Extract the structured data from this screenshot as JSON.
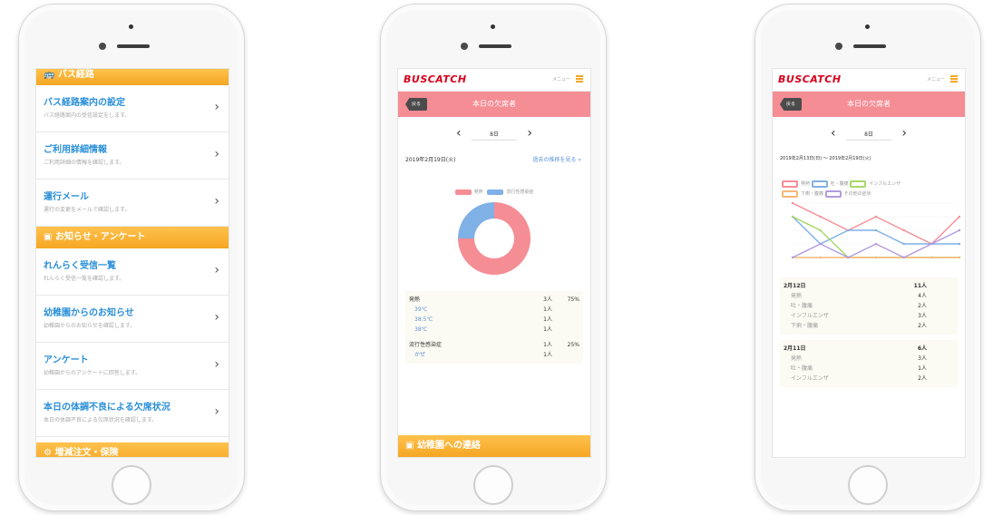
{
  "phone1": {
    "top_section": "バス経路",
    "items": [
      {
        "title": "バス経路案内の設定",
        "sub": "バス経路案内の受信設定をします。"
      },
      {
        "title": "ご利用詳細情報",
        "sub": "ご利用詳細の情報を確認します。"
      },
      {
        "title": "運行メール",
        "sub": "運行の変更をメールで確認します。"
      }
    ],
    "section2": "お知らせ・アンケート",
    "items2": [
      {
        "title": "れんらく受信一覧",
        "sub": "れんらく受信一覧を確認します。"
      },
      {
        "title": "幼稚園からのお知らせ",
        "sub": "幼稚園からのお知らせを確認します。"
      },
      {
        "title": "アンケート",
        "sub": "幼稚園からのアンケートに回答します。"
      },
      {
        "title": "本日の体調不良による欠席状況",
        "sub": "本日の体調不良による欠席状況を確認します。"
      }
    ],
    "bottom_section": "増減注文・保険"
  },
  "phone2": {
    "logo": "BUSCATCH",
    "menu_label": "メニュー",
    "title": "本日の欠席者",
    "back": "戻る",
    "date": "8日",
    "date_full": "2019年2月19日(火)",
    "past_link": "過去の推移を見る",
    "legend": [
      "発熱",
      "流行性感染症"
    ],
    "table": [
      {
        "label": "発熱",
        "count": "3人",
        "pct": "75%",
        "kind": "head"
      },
      {
        "label": "39℃",
        "count": "1人",
        "kind": "sub"
      },
      {
        "label": "38.5℃",
        "count": "1人",
        "kind": "sub"
      },
      {
        "label": "38℃",
        "count": "1人",
        "kind": "sub"
      },
      {
        "label": "流行性感染症",
        "count": "1人",
        "pct": "25%",
        "kind": "head"
      },
      {
        "label": "かぜ",
        "count": "1人",
        "kind": "sub"
      }
    ],
    "footer": "幼稚園への連絡"
  },
  "phone3": {
    "logo": "BUSCATCH",
    "menu_label": "メニュー",
    "title": "本日の欠席者",
    "back": "戻る",
    "date": "8日",
    "date_range": "2019年2月13日(日) 〜 2019年2月19日(火)",
    "legend": [
      "発熱",
      "吐・腹痛",
      "インフルエンザ",
      "下痢・腹痛",
      "その他の症状"
    ],
    "day1": {
      "title": "2月12日",
      "total": "11人",
      "rows": [
        {
          "label": "発熱",
          "count": "4人"
        },
        {
          "label": "吐・腹痛",
          "count": "2人"
        },
        {
          "label": "インフルエンザ",
          "count": "3人"
        },
        {
          "label": "下痢・腹痛",
          "count": "2人"
        }
      ]
    },
    "day2": {
      "title": "2月11日",
      "total": "6人",
      "rows": [
        {
          "label": "発熱",
          "count": "3人"
        },
        {
          "label": "吐・腹痛",
          "count": "1人"
        },
        {
          "label": "インフルエンザ",
          "count": "2人"
        }
      ]
    }
  },
  "colors": {
    "orange": "#f5a623",
    "pink": "#f58d95",
    "blue": "#2a8fd8",
    "donut_pink": "#f58d95",
    "donut_blue": "#7fb0e6"
  },
  "donut": [
    {
      "label": "発熱",
      "percent": 75
    },
    {
      "label": "流行性感染症",
      "percent": 25
    }
  ],
  "line_series": [
    {
      "label": "発熱",
      "color": "#f58d95",
      "values": [
        4,
        3,
        2,
        3,
        2,
        1,
        3
      ]
    },
    {
      "label": "吐・腹痛",
      "color": "#7fb0e6",
      "values": [
        3,
        1,
        2,
        2,
        1,
        1,
        1
      ]
    },
    {
      "label": "インフルエンザ",
      "color": "#a5d86a",
      "values": [
        3,
        2,
        0,
        0,
        0,
        0,
        0
      ]
    },
    {
      "label": "下痢・腹痛",
      "color": "#f7b877",
      "values": [
        0,
        0,
        0,
        0,
        0,
        0,
        0
      ]
    },
    {
      "label": "その他の症状",
      "color": "#b29ae0",
      "values": [
        0,
        1,
        0,
        1,
        0,
        1,
        2
      ]
    }
  ]
}
